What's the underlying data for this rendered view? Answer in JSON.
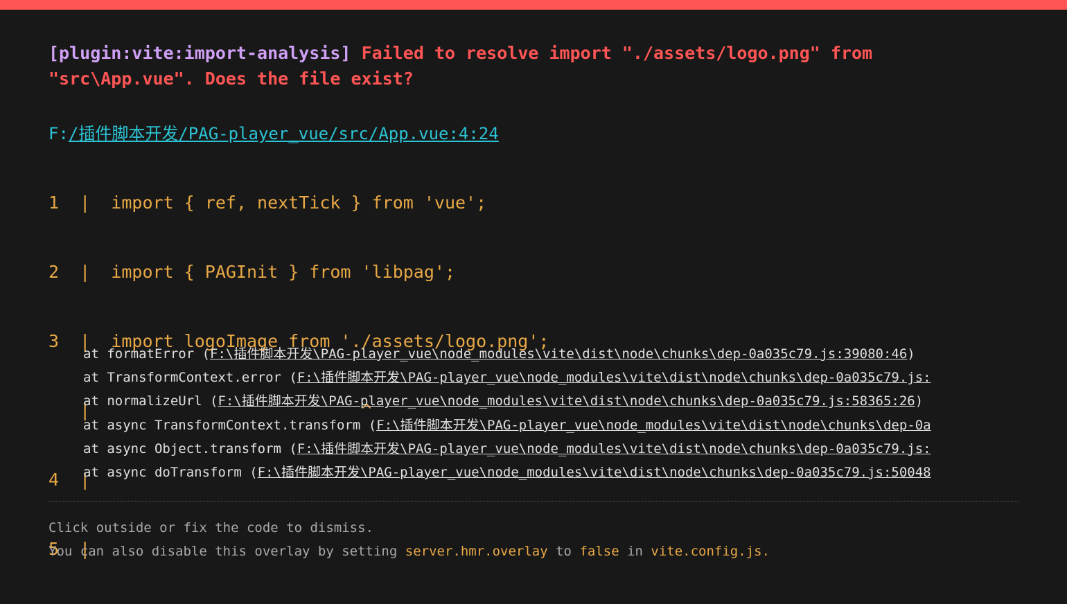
{
  "header": {
    "plugin": "[plugin:vite:import-analysis]",
    "message": "Failed to resolve import \"./assets/logo.png\" from \"src\\App.vue\". Does the file exist?"
  },
  "file": {
    "drive": "F:",
    "path": "/插件脚本开发/PAG-player_vue/src/App.vue:4:24"
  },
  "code_frame": {
    "lines": [
      "1  |  import { ref, nextTick } from 'vue';",
      "2  |  import { PAGInit } from 'libpag';",
      "3  |  import logoImage from './assets/logo.png';",
      "   |                          ^",
      "4  |",
      "5  |"
    ]
  },
  "stack": [
    {
      "fn": "at formatError (",
      "loc": "F:\\插件脚本开发\\PAG-player_vue\\node_modules\\vite\\dist\\node\\chunks\\dep-0a035c79.js:39080:46",
      "end": ")"
    },
    {
      "fn": "at TransformContext.error (",
      "loc": "F:\\插件脚本开发\\PAG-player_vue\\node_modules\\vite\\dist\\node\\chunks\\dep-0a035c79.js:",
      "end": ""
    },
    {
      "fn": "at normalizeUrl (",
      "loc": "F:\\插件脚本开发\\PAG-player_vue\\node_modules\\vite\\dist\\node\\chunks\\dep-0a035c79.js:58365:26",
      "end": ")"
    },
    {
      "fn": "at async TransformContext.transform (",
      "loc": "F:\\插件脚本开发\\PAG-player_vue\\node_modules\\vite\\dist\\node\\chunks\\dep-0a",
      "end": ""
    },
    {
      "fn": "at async Object.transform (",
      "loc": "F:\\插件脚本开发\\PAG-player_vue\\node_modules\\vite\\dist\\node\\chunks\\dep-0a035c79.js:",
      "end": ""
    },
    {
      "fn": "at async doTransform (",
      "loc": "F:\\插件脚本开发\\PAG-player_vue\\node_modules\\vite\\dist\\node\\chunks\\dep-0a035c79.js:50048",
      "end": ""
    }
  ],
  "tip": {
    "line1": "Click outside or fix the code to dismiss.",
    "line2_prefix": "You can also disable this overlay by setting ",
    "line2_code1": "server.hmr.overlay",
    "line2_mid1": " to ",
    "line2_code2": "false",
    "line2_mid2": " in ",
    "line2_code3": "vite.config.js."
  },
  "colors": {
    "top_bar": "#ff5555",
    "background": "#181818",
    "plugin": "#cfa0f5",
    "message": "#ff5555",
    "file_link": "#2bc3d3",
    "code_frame": "#e8a845",
    "stack_text": "#e0e0e0",
    "tip_text": "#a9a9a9"
  }
}
